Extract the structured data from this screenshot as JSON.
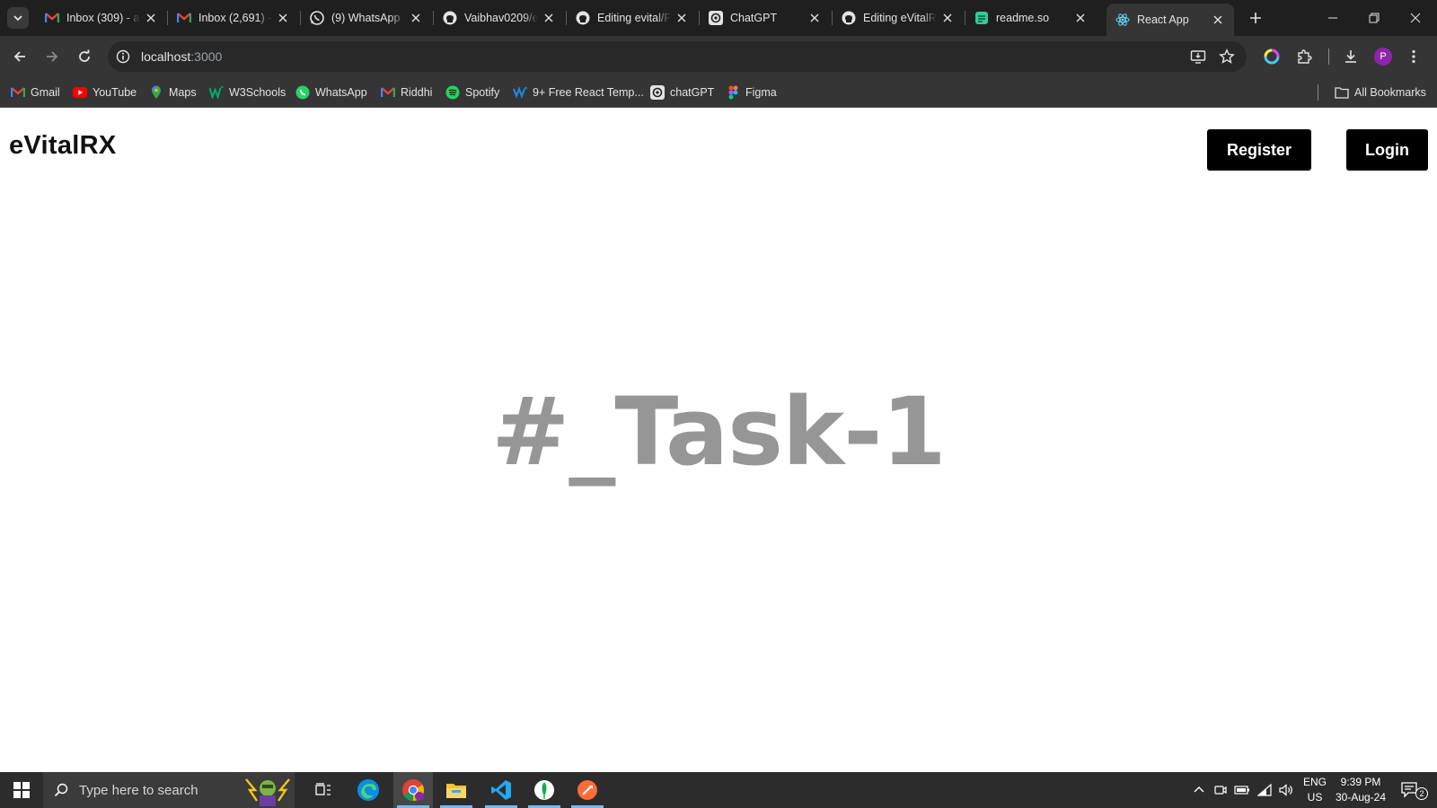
{
  "browser": {
    "tabs": [
      {
        "title": "Inbox (309) - a",
        "icon": "gmail-icon"
      },
      {
        "title": "Inbox (2,691) -",
        "icon": "gmail-icon"
      },
      {
        "title": "(9) WhatsApp",
        "icon": "whatsapp-icon"
      },
      {
        "title": "Vaibhav0209/e",
        "icon": "github-icon"
      },
      {
        "title": "Editing evital/F",
        "icon": "github-icon"
      },
      {
        "title": "ChatGPT",
        "icon": "chatgpt-icon"
      },
      {
        "title": "Editing eVitalR",
        "icon": "github-icon"
      },
      {
        "title": "readme.so",
        "icon": "readme-icon"
      },
      {
        "title": "React App",
        "icon": "react-icon"
      }
    ],
    "active_tab": 8,
    "address": {
      "host": "localhost",
      "port": ":3000"
    },
    "bookmarks": [
      {
        "label": "Gmail",
        "icon": "gmail-icon"
      },
      {
        "label": "YouTube",
        "icon": "youtube-icon"
      },
      {
        "label": "Maps",
        "icon": "maps-icon"
      },
      {
        "label": "W3Schools",
        "icon": "w3schools-icon"
      },
      {
        "label": "WhatsApp",
        "icon": "whatsapp-icon"
      },
      {
        "label": "Riddhi",
        "icon": "gmail-icon"
      },
      {
        "label": "Spotify",
        "icon": "spotify-icon"
      },
      {
        "label": "9+ Free React Temp...",
        "icon": "template-icon"
      },
      {
        "label": "chatGPT",
        "icon": "chatgpt-icon"
      },
      {
        "label": "Figma",
        "icon": "figma-icon"
      }
    ],
    "all_bookmarks_label": "All Bookmarks",
    "profile_initial": "P"
  },
  "app": {
    "brand": "eVitalRX",
    "register_label": "Register",
    "login_label": "Login",
    "hero_text": "#_Task-1"
  },
  "taskbar": {
    "search_placeholder": "Type here to search",
    "language": "ENG",
    "region": "US",
    "time": "9:39 PM",
    "date": "30-Aug-24",
    "notification_count": "2"
  },
  "colors": {
    "accent_blue": "#76b9ed",
    "hero_gray": "#969696",
    "button_black": "#000000"
  }
}
